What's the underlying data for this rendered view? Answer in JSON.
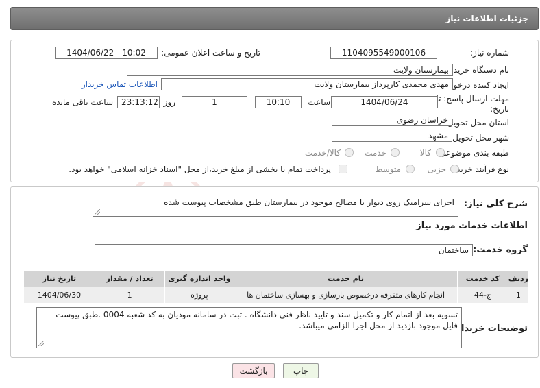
{
  "header": {
    "title": "جزئیات اطلاعات نیاز"
  },
  "form": {
    "need_number_label": "شماره نیاز:",
    "need_number": "1104095549000106",
    "announce_label": "تاریخ و ساعت اعلان عمومی:",
    "announce_value": "1404/06/22 - 10:02",
    "buyer_org_label": "نام دستگاه خریدار:",
    "buyer_org": "بیمارستان ولایت",
    "creator_label": "ایجاد کننده درخواست:",
    "creator": "مهدی محمدی کارپرداز بیمارستان ولایت",
    "contact_link": "اطلاعات تماس خریدار",
    "deadline_label_1": "مهلت ارسال پاسخ: تا",
    "deadline_label_2": "تاریخ:",
    "deadline_date": "1404/06/24",
    "time_label": "ساعت",
    "deadline_time": "10:10",
    "days_value": "1",
    "days_label": "روز و",
    "remaining_time": "23:13:12",
    "remaining_label": "ساعت باقی مانده",
    "province_label": "استان محل تحویل:",
    "province": "خراسان رضوی",
    "city_label": "شهر محل تحویل:",
    "city": "مشهد",
    "category_label": "طبقه بندی موضوعی:",
    "category_options": [
      "کالا",
      "خدمت",
      "کالا/خدمت"
    ],
    "process_label": "نوع فرآیند خرید :",
    "process_options": [
      "جزیی",
      "متوسط"
    ],
    "payment_note": "پرداخت تمام یا بخشی از مبلغ خرید،از محل \"اسناد خزانه اسلامی\" خواهد بود."
  },
  "summary": {
    "label": "شرح کلی نیاز:",
    "text": "اجرای سرامیک روی دیوار با مصالح موجود در بیمارستان طبق مشخصات پیوست شده"
  },
  "services": {
    "section_title": "اطلاعات خدمات مورد نیاز",
    "group_label": "گروه خدمت:",
    "group_value": "ساختمان",
    "columns": [
      "ردیف",
      "کد خدمت",
      "نام خدمت",
      "واحد اندازه گیری",
      "تعداد / مقدار",
      "تاریخ نیاز"
    ],
    "rows": [
      [
        "1",
        "ج-44",
        "انجام کارهای متفرقه درخصوص بازسازی و بهسازی ساختمان ها",
        "پروژه",
        "1",
        "1404/06/30"
      ]
    ]
  },
  "buyer_notes": {
    "label": "توضیحات خریدار:",
    "text": "تسویه بعد از اتمام کار و تکمیل سند و تایید ناظر فنی دانشگاه . ثبت در سامانه مودیان به کد شعبه 0004 .طبق پیوست فایل موجود بازدید از محل اجرا الزامی میباشد."
  },
  "buttons": {
    "print": "چاپ",
    "back": "بازگشت"
  },
  "watermark": {
    "brand": "AriaTender.neT"
  }
}
